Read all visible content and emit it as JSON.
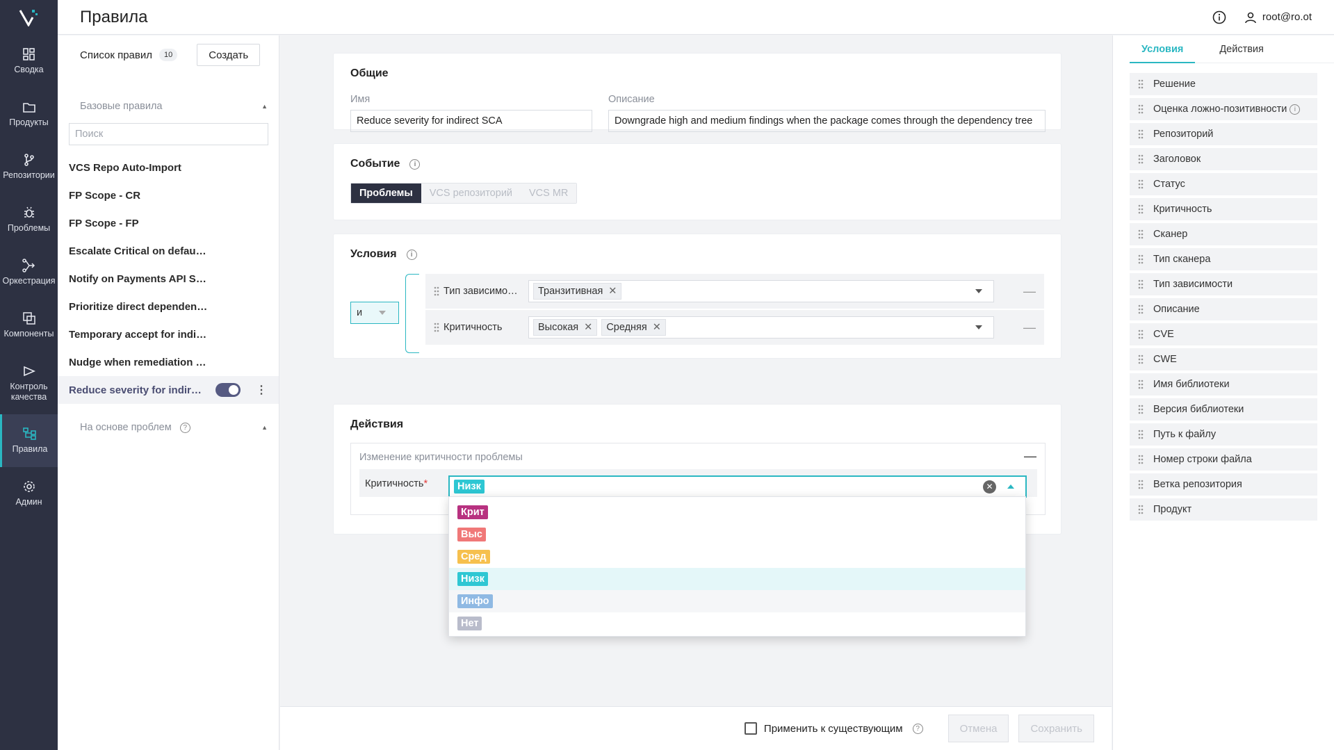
{
  "nav": {
    "items": [
      {
        "label": "Сводка",
        "icon": "dashboard-icon"
      },
      {
        "label": "Продукты",
        "icon": "folder-icon"
      },
      {
        "label": "Репозитории",
        "icon": "branch-icon"
      },
      {
        "label": "Проблемы",
        "icon": "bug-icon"
      },
      {
        "label": "Оркестрация",
        "icon": "orchestration-icon"
      },
      {
        "label": "Компоненты",
        "icon": "components-icon"
      },
      {
        "label": "Контроль качества",
        "icon": "play-icon"
      },
      {
        "label": "Правила",
        "icon": "rules-icon"
      },
      {
        "label": "Админ",
        "icon": "gear-icon"
      }
    ],
    "active": "Правила"
  },
  "header": {
    "title": "Правила",
    "user": "root@ro.ot"
  },
  "rules_list": {
    "title": "Список правил",
    "count": "10",
    "create_label": "Создать",
    "group1": "Базовые правила",
    "search_placeholder": "Поиск",
    "items": [
      "VCS Repo Auto-Import",
      "FP Scope - CR",
      "FP Scope - FP",
      "Escalate Critical on default br...",
      "Notify on Payments API SCA c...",
      "Prioritize direct dependency fi...",
      "Temporary accept for indirect ...",
      "Nudge when remediation is kn...",
      "Reduce severity for indirect S..."
    ],
    "group2": "На основе проблем"
  },
  "general": {
    "title": "Общие",
    "name_label": "Имя",
    "name_value": "Reduce severity for indirect SCA",
    "desc_label": "Описание",
    "desc_value": "Downgrade high and medium findings when the package comes through the dependency tree"
  },
  "event": {
    "title": "Событие",
    "options": [
      "Проблемы",
      "VCS репозиторий",
      "VCS MR"
    ],
    "selected": "Проблемы"
  },
  "conditions": {
    "title": "Условия",
    "operator": "и",
    "rows": [
      {
        "name": "Тип зависимос...",
        "tags": [
          "Транзитивная"
        ]
      },
      {
        "name": "Критичность",
        "tags": [
          "Высокая",
          "Средняя"
        ]
      }
    ]
  },
  "actions": {
    "title": "Действия",
    "block_title": "Изменение критичности проблемы",
    "field_label": "Критичность",
    "required_mark": "*",
    "selected": "Низк",
    "options": [
      {
        "label": "Крит",
        "color": "#b83280"
      },
      {
        "label": "Выс",
        "color": "#f07878"
      },
      {
        "label": "Сред",
        "color": "#f6c04e"
      },
      {
        "label": "Низк",
        "color": "#2ec7d3"
      },
      {
        "label": "Инфо",
        "color": "#8fb9e3"
      },
      {
        "label": "Нет",
        "color": "#b9bccb"
      }
    ]
  },
  "footer": {
    "apply_label": "Применить к существующим",
    "cancel": "Отмена",
    "save": "Сохранить"
  },
  "right_panel": {
    "tabs": [
      "Условия",
      "Действия"
    ],
    "fields": [
      "Решение",
      "Оценка ложно-позитивности",
      "Репозиторий",
      "Заголовок",
      "Статус",
      "Критичность",
      "Сканер",
      "Тип сканера",
      "Тип зависимости",
      "Описание",
      "CVE",
      "CWE",
      "Имя библиотеки",
      "Версия библиотеки",
      "Путь к файлу",
      "Номер строки файла",
      "Ветка репозитория",
      "Продукт"
    ]
  },
  "colors": {
    "accent": "#2ab7c2",
    "nav_bg": "#2d3142"
  }
}
